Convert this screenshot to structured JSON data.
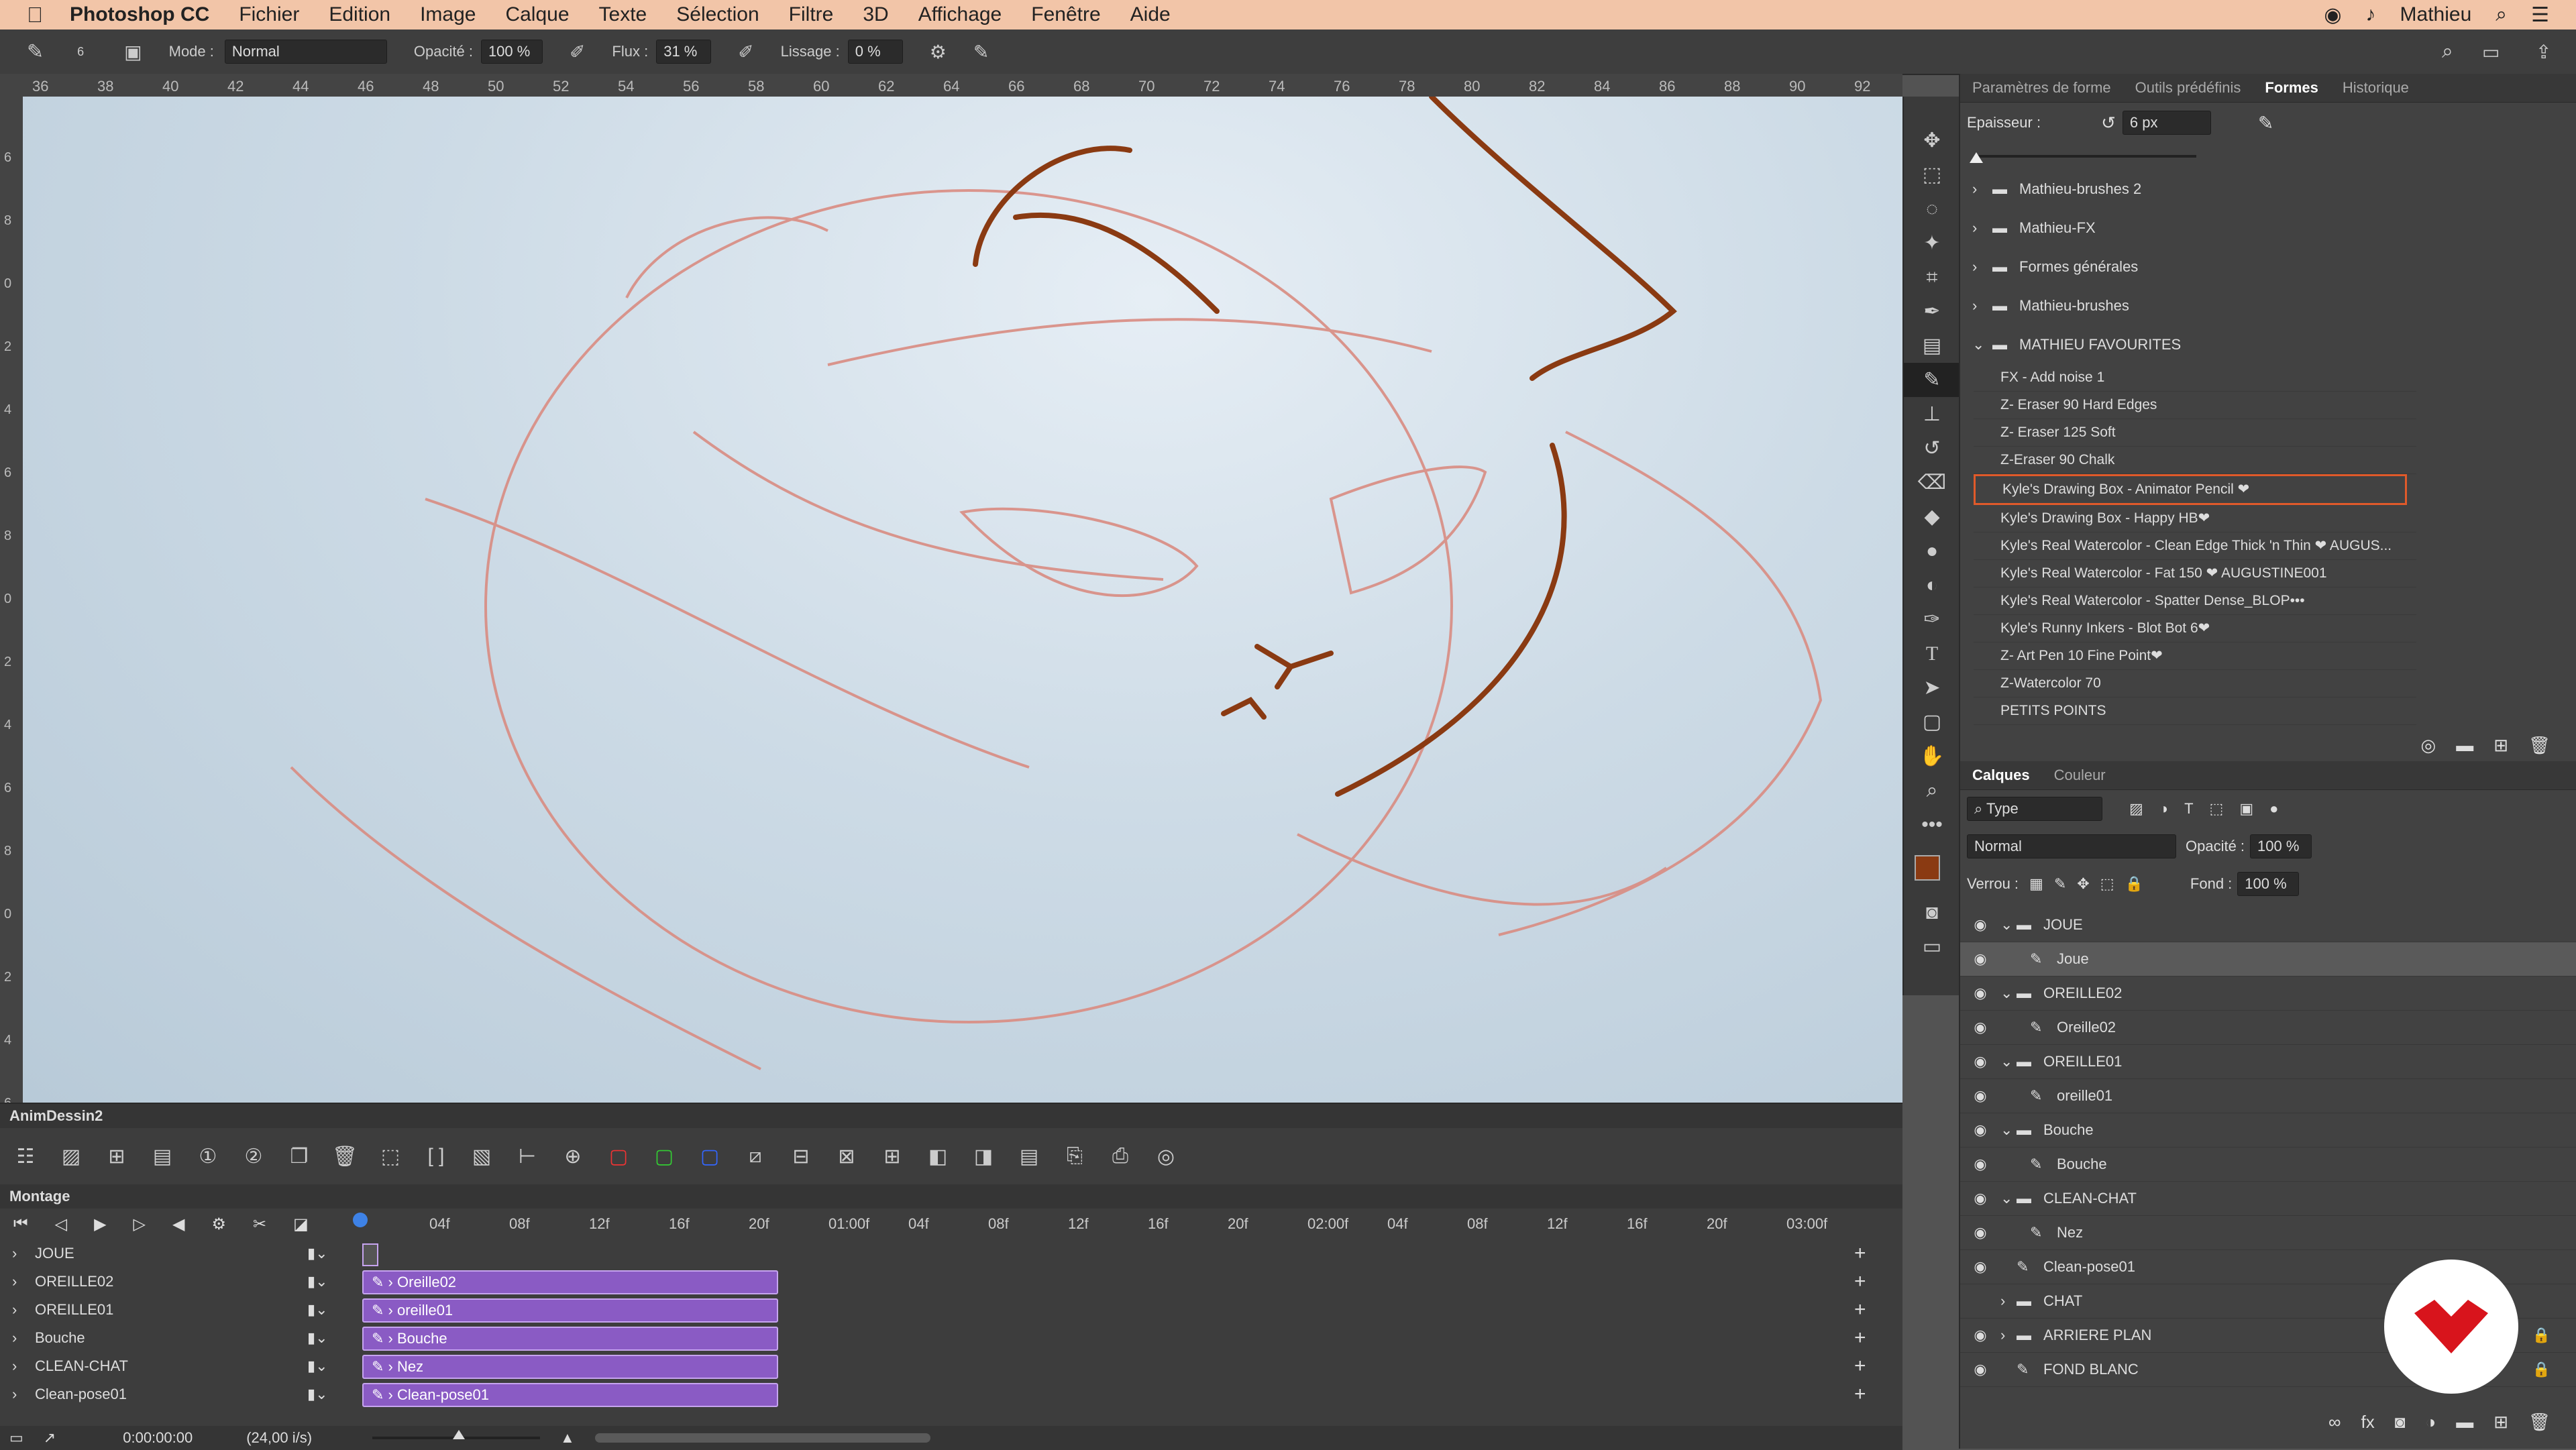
{
  "menubar": {
    "app": "Photoshop CC",
    "items": [
      "Fichier",
      "Edition",
      "Image",
      "Calque",
      "Texte",
      "Sélection",
      "Filtre",
      "3D",
      "Affichage",
      "Fenêtre",
      "Aide"
    ],
    "user": "Mathieu"
  },
  "options": {
    "brush_size": "6",
    "mode_label": "Mode :",
    "mode_value": "Normal",
    "opacity_label": "Opacité :",
    "opacity_value": "100 %",
    "flow_label": "Flux :",
    "flow_value": "31 %",
    "smoothing_label": "Lissage :",
    "smoothing_value": "0 %"
  },
  "ruler": [
    "36",
    "38",
    "40",
    "42",
    "44",
    "46",
    "48",
    "50",
    "52",
    "54",
    "56",
    "58",
    "60",
    "62",
    "64",
    "66",
    "68",
    "70",
    "72",
    "74",
    "76",
    "78",
    "80",
    "82",
    "84",
    "86",
    "88",
    "90",
    "92"
  ],
  "vruler": [
    "6",
    "8",
    "0",
    "2",
    "4",
    "6",
    "8",
    "0",
    "2",
    "4",
    "6",
    "8",
    "0",
    "2",
    "4",
    "6"
  ],
  "brush_panel": {
    "tabs": [
      "Paramètres de forme",
      "Outils prédéfinis",
      "Formes",
      "Historique"
    ],
    "active_tab": "Formes",
    "thickness_label": "Epaisseur :",
    "thickness_value": "6 px",
    "folders": [
      "Mathieu-brushes  2",
      "Mathieu-FX",
      "Formes générales",
      "Mathieu-brushes",
      "MATHIEU FAVOURITES"
    ],
    "brushes": [
      "FX - Add noise 1",
      "Z- Eraser 90 Hard Edges",
      "Z- Eraser 125 Soft",
      "Z-Eraser 90 Chalk",
      "Kyle's Drawing Box - Animator Pencil ❤",
      "Kyle's Drawing Box - Happy HB❤",
      "Kyle's Real Watercolor - Clean Edge Thick 'n Thin ❤ AUGUS...",
      "Kyle's Real Watercolor - Fat 150 ❤ AUGUSTINE001",
      "Kyle's Real Watercolor - Spatter Dense_BLOP•••",
      "Kyle's Runny Inkers - Blot Bot 6❤",
      "Z- Art Pen 10 Fine Point❤",
      "Z-Watercolor 70",
      "PETITS POINTS"
    ],
    "selected_index": 4
  },
  "layers_panel": {
    "tabs": [
      "Calques",
      "Couleur"
    ],
    "filter_label": "Type",
    "blend_mode": "Normal",
    "opacity_label": "Opacité :",
    "opacity_value": "100 %",
    "lock_label": "Verrou :",
    "fill_label": "Fond :",
    "fill_value": "100 %",
    "layers": [
      {
        "name": "JOUE",
        "type": "group",
        "indent": 0
      },
      {
        "name": "Joue",
        "type": "layer",
        "indent": 1
      },
      {
        "name": "OREILLE02",
        "type": "group",
        "indent": 0
      },
      {
        "name": "Oreille02",
        "type": "layer",
        "indent": 1
      },
      {
        "name": "OREILLE01",
        "type": "group",
        "indent": 0
      },
      {
        "name": "oreille01",
        "type": "layer",
        "indent": 1
      },
      {
        "name": "Bouche",
        "type": "group",
        "indent": 0
      },
      {
        "name": "Bouche",
        "type": "layer",
        "indent": 1
      },
      {
        "name": "CLEAN-CHAT",
        "type": "group",
        "indent": 0
      },
      {
        "name": "Nez",
        "type": "layer",
        "indent": 1
      },
      {
        "name": "Clean-pose01",
        "type": "layer",
        "indent": 0
      },
      {
        "name": "CHAT",
        "type": "group",
        "indent": 0
      },
      {
        "name": "ARRIERE PLAN",
        "type": "group",
        "indent": 0
      },
      {
        "name": "FOND BLANC",
        "type": "layer",
        "indent": 0
      }
    ]
  },
  "colors": {
    "foreground": "#8a3a12",
    "background": "#111111",
    "clip": "#8a5bc4",
    "selection": "#e05a2a"
  },
  "timeline": {
    "panel_title": "AnimDessin2",
    "section_title": "Montage",
    "ticks": [
      "04f",
      "08f",
      "12f",
      "16f",
      "20f",
      "01:00f",
      "04f",
      "08f",
      "12f",
      "16f",
      "20f",
      "02:00f",
      "04f",
      "08f",
      "12f",
      "16f",
      "20f",
      "03:00f"
    ],
    "tracks": [
      {
        "name": "JOUE",
        "clip": ""
      },
      {
        "name": "OREILLE02",
        "clip": "Oreille02"
      },
      {
        "name": "OREILLE01",
        "clip": "oreille01"
      },
      {
        "name": "Bouche",
        "clip": "Bouche"
      },
      {
        "name": "CLEAN-CHAT",
        "clip": "Nez"
      },
      {
        "name": "Clean-pose01",
        "clip": "Clean-pose01"
      }
    ],
    "timecode": "0:00:00:00",
    "fps": "(24,00 i/s)"
  }
}
